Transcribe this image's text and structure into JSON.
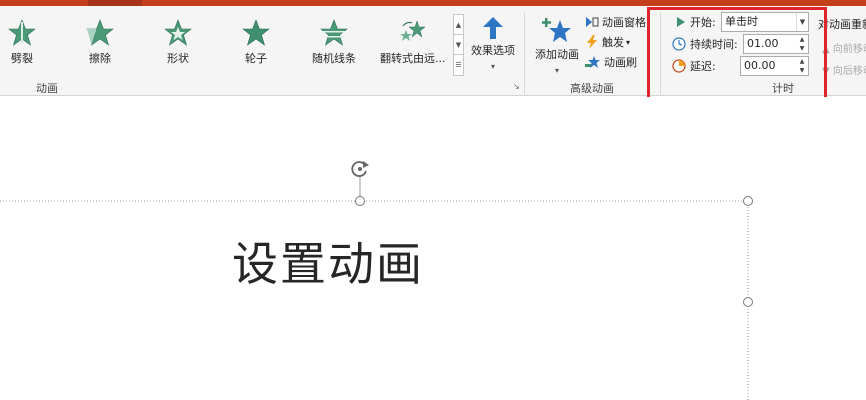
{
  "ribbon": {
    "animations": [
      {
        "label": "劈裂",
        "icon": "split-star-icon"
      },
      {
        "label": "擦除",
        "icon": "wipe-star-icon"
      },
      {
        "label": "形状",
        "icon": "shape-star-icon"
      },
      {
        "label": "轮子",
        "icon": "wheel-star-icon"
      },
      {
        "label": "随机线条",
        "icon": "random-bars-star-icon"
      },
      {
        "label": "翻转式由远...",
        "icon": "flip-star-icon"
      }
    ],
    "effect_options_label": "效果选项",
    "animation_group_label": "动画",
    "advanced": {
      "add_animation_label": "添加动画",
      "pane_label": "动画窗格",
      "trigger_label": "触发",
      "painter_label": "动画刷",
      "group_label": "高级动画"
    },
    "timing": {
      "start_label": "开始:",
      "start_value": "单击时",
      "duration_label": "持续时间:",
      "duration_value": "01.00",
      "delay_label": "延迟:",
      "delay_value": "00.00",
      "group_label": "计时"
    },
    "reorder": {
      "title": "对动画重新排序",
      "earlier": "向前移动",
      "later": "向后移动"
    }
  },
  "slide": {
    "title_text": "设置动画"
  },
  "colors": {
    "accent": "#c43e1c",
    "highlight": "#e0242b",
    "star_green": "#3f8f6e",
    "blue": "#2e75c6"
  }
}
